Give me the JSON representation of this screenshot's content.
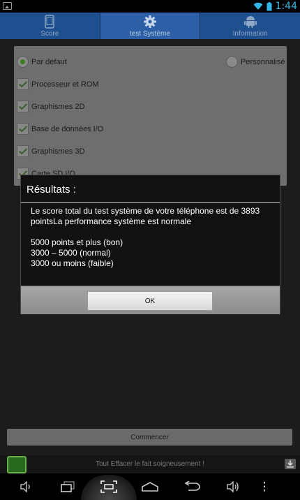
{
  "status_bar": {
    "time": "1:44"
  },
  "tabs": [
    {
      "label": "Score",
      "icon": "phone-icon",
      "active": false
    },
    {
      "label": "test Système",
      "icon": "gear-icon",
      "active": true
    },
    {
      "label": "Information",
      "icon": "android-icon",
      "active": false
    }
  ],
  "options": {
    "default_label": "Par défaut",
    "custom_label": "Personnalisé",
    "checks": [
      "Processeur et ROM",
      "Graphismes 2D",
      "Base de données I/O",
      "Graphismes 3D",
      "Carte SD I/O"
    ]
  },
  "dialog": {
    "title": "Résultats :",
    "line1": "Le score total du test système de votre téléphone est de 3893",
    "line2": "pointsLa performance système est normale",
    "ranges": [
      "5000 points et plus (bon)",
      "3000 – 5000 (normal)",
      "3000 ou moins (faible)"
    ],
    "ok_label": "OK"
  },
  "start_label": "Commencer",
  "ad": {
    "text": "Tout Effacer le fait soigneusement !"
  },
  "colors": {
    "accent": "#33b5e5",
    "tab_bg": "#1e4f8e",
    "tab_active": "#2c5fa5"
  }
}
